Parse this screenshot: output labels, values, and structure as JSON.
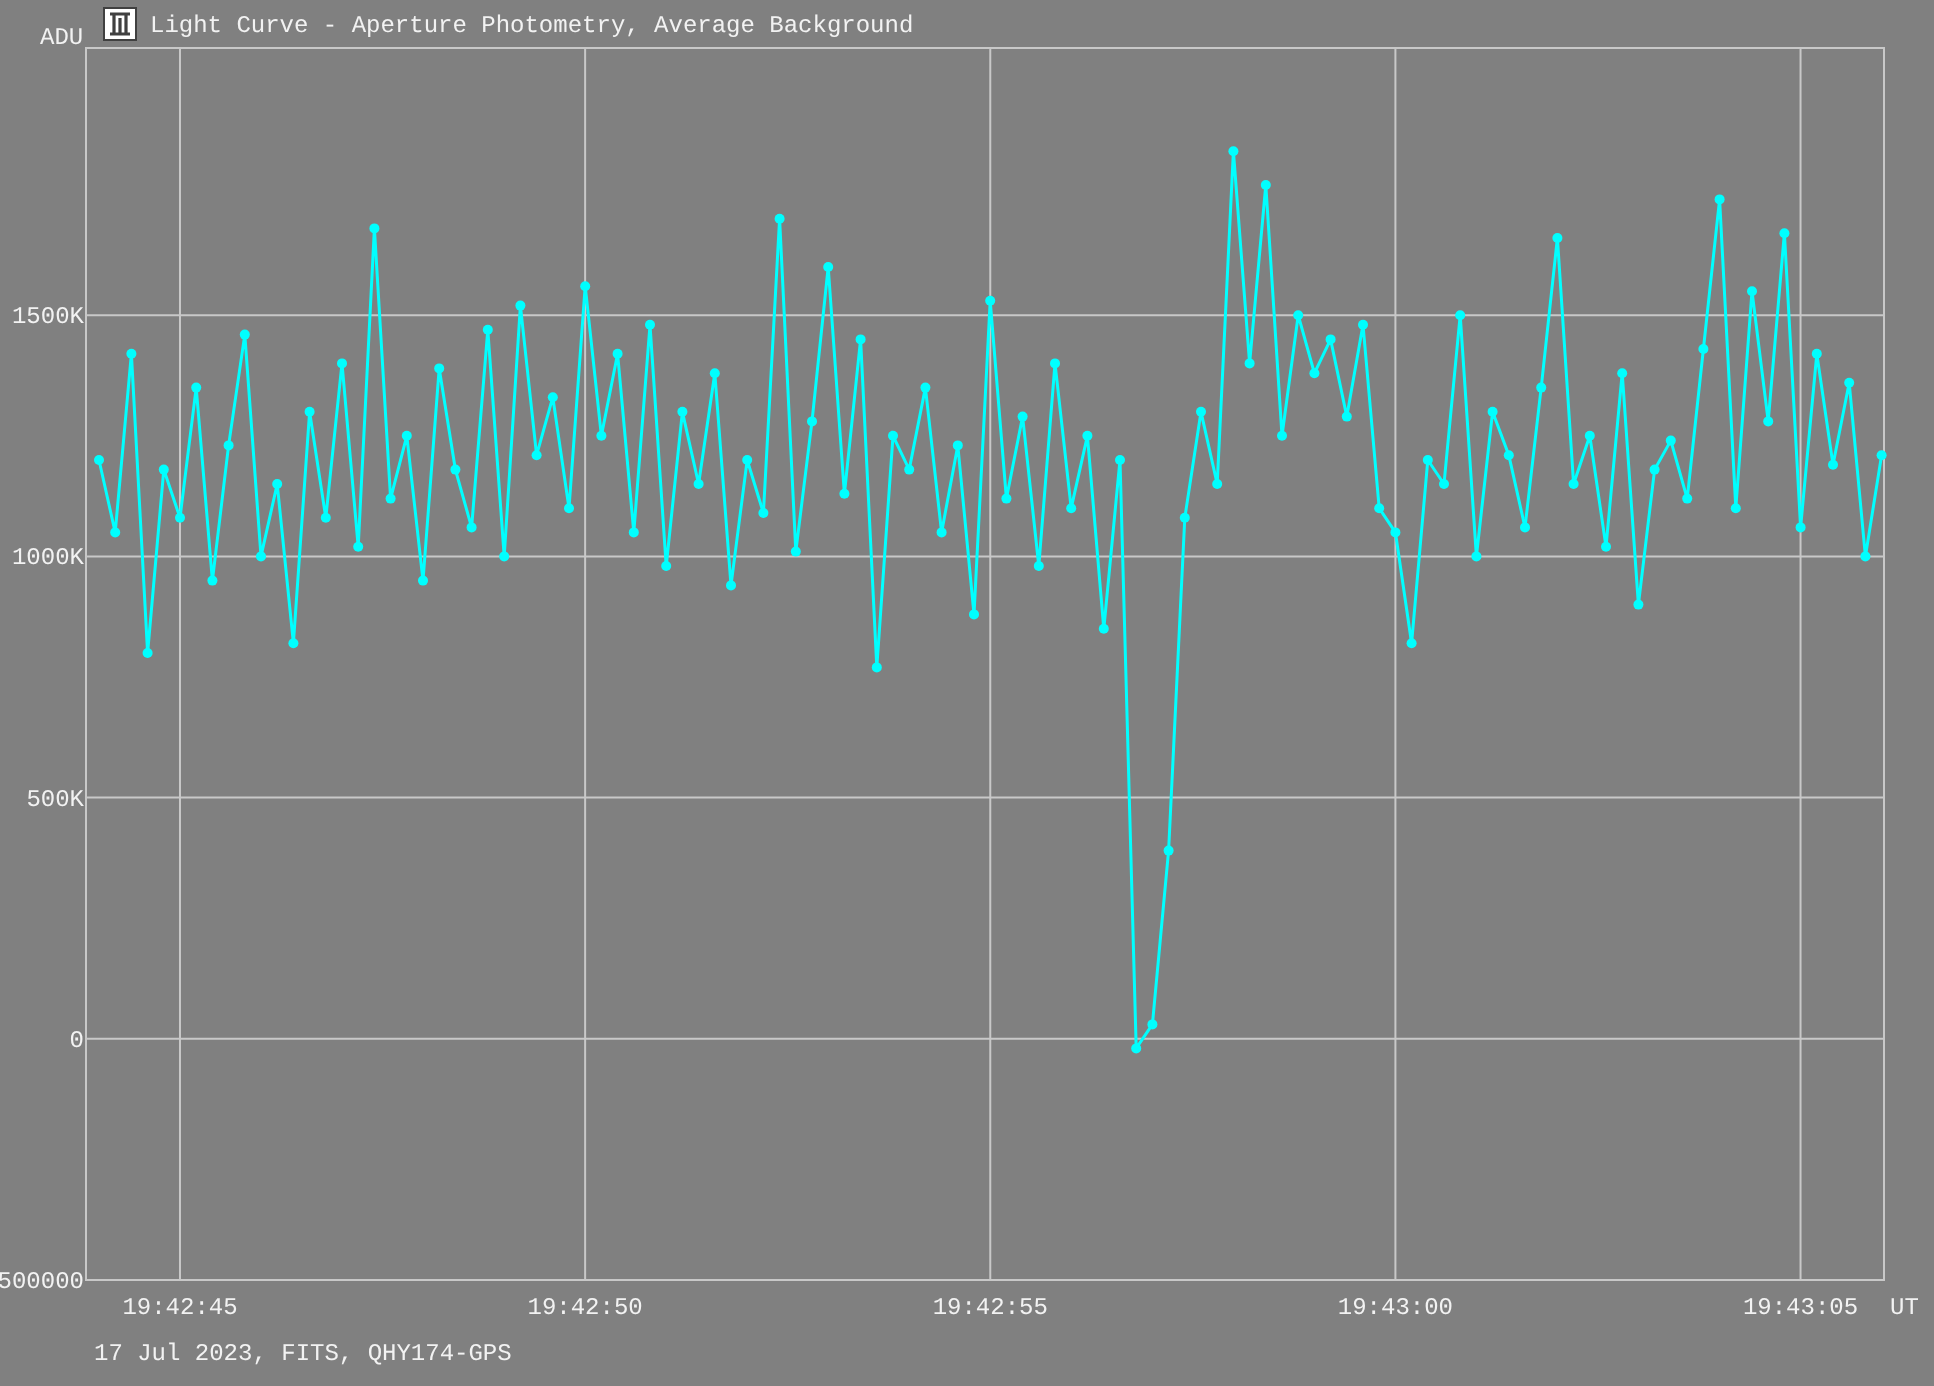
{
  "window": {
    "title": "Light Curve - Aperture Photometry, Average Background"
  },
  "plot": {
    "chart_data": {
      "type": "line",
      "grid": true,
      "xlabel": "UT",
      "ylabel": "ADU",
      "xlim": [
        70963.84,
        70986.03
      ],
      "ylim": [
        -500000,
        2054000
      ],
      "xticks": [
        {
          "value": 70965,
          "label": "19:42:45"
        },
        {
          "value": 70970,
          "label": "19:42:50"
        },
        {
          "value": 70975,
          "label": "19:42:55"
        },
        {
          "value": 70980,
          "label": "19:43:00"
        },
        {
          "value": 70985,
          "label": "19:43:05"
        }
      ],
      "yticks": [
        {
          "value": -500000,
          "label": "500000"
        },
        {
          "value": 0,
          "label": "0"
        },
        {
          "value": 500000,
          "label": "500K"
        },
        {
          "value": 1000000,
          "label": "1000K"
        },
        {
          "value": 1500000,
          "label": "1500K"
        }
      ],
      "x": [
        70964.0,
        70964.2,
        70964.4,
        70964.6,
        70964.8,
        70965.0,
        70965.2,
        70965.4,
        70965.6,
        70965.8,
        70966.0,
        70966.2,
        70966.4,
        70966.6,
        70966.8,
        70967.0,
        70967.2,
        70967.4,
        70967.6,
        70967.8,
        70968.0,
        70968.2,
        70968.4,
        70968.6,
        70968.8,
        70969.0,
        70969.2,
        70969.4,
        70969.6,
        70969.8,
        70970.0,
        70970.2,
        70970.4,
        70970.6,
        70970.8,
        70971.0,
        70971.2,
        70971.4,
        70971.6,
        70971.8,
        70972.0,
        70972.2,
        70972.4,
        70972.6,
        70972.8,
        70973.0,
        70973.2,
        70973.4,
        70973.6,
        70973.8,
        70974.0,
        70974.2,
        70974.4,
        70974.6,
        70974.8,
        70975.0,
        70975.2,
        70975.4,
        70975.6,
        70975.8,
        70976.0,
        70976.2,
        70976.4,
        70976.6,
        70976.8,
        70977.0,
        70977.2,
        70977.4,
        70977.6,
        70977.8,
        70978.0,
        70978.2,
        70978.4,
        70978.6,
        70978.8,
        70979.0,
        70979.2,
        70979.4,
        70979.6,
        70979.8,
        70980.0,
        70980.2,
        70980.4,
        70980.6,
        70980.8,
        70981.0,
        70981.2,
        70981.4,
        70981.6,
        70981.8,
        70982.0,
        70982.2,
        70982.4,
        70982.6,
        70982.8,
        70983.0,
        70983.2,
        70983.4,
        70983.6,
        70983.8,
        70984.0,
        70984.2,
        70984.4,
        70984.6,
        70984.8,
        70985.0,
        70985.2,
        70985.4,
        70985.6,
        70985.8,
        70986.0
      ],
      "series": [
        {
          "marker": "circle",
          "color": "#00ffff",
          "values": [
            1200000,
            1050000,
            1420000,
            800000,
            1180000,
            1080000,
            1350000,
            950000,
            1230000,
            1460000,
            1000000,
            1150000,
            820000,
            1300000,
            1080000,
            1400000,
            1020000,
            1680000,
            1120000,
            1250000,
            950000,
            1390000,
            1180000,
            1060000,
            1470000,
            1000000,
            1520000,
            1210000,
            1330000,
            1100000,
            1560000,
            1250000,
            1420000,
            1050000,
            1480000,
            980000,
            1300000,
            1150000,
            1380000,
            940000,
            1200000,
            1090000,
            1700000,
            1010000,
            1280000,
            1600000,
            1130000,
            1450000,
            770000,
            1250000,
            1180000,
            1350000,
            1050000,
            1230000,
            880000,
            1530000,
            1120000,
            1290000,
            980000,
            1400000,
            1100000,
            1250000,
            850000,
            1200000,
            -20000,
            30000,
            390000,
            1080000,
            1300000,
            1150000,
            1840000,
            1400000,
            1770000,
            1250000,
            1500000,
            1380000,
            1450000,
            1290000,
            1480000,
            1100000,
            1050000,
            820000,
            1200000,
            1150000,
            1500000,
            1000000,
            1300000,
            1210000,
            1060000,
            1350000,
            1660000,
            1150000,
            1250000,
            1020000,
            1380000,
            900000,
            1180000,
            1240000,
            1120000,
            1430000,
            1740000,
            1100000,
            1550000,
            1280000,
            1670000,
            1060000,
            1420000,
            1190000,
            1360000,
            1000000,
            1210000
          ]
        }
      ]
    }
  },
  "footer": "17 Jul 2023, FITS, QHY174-GPS"
}
